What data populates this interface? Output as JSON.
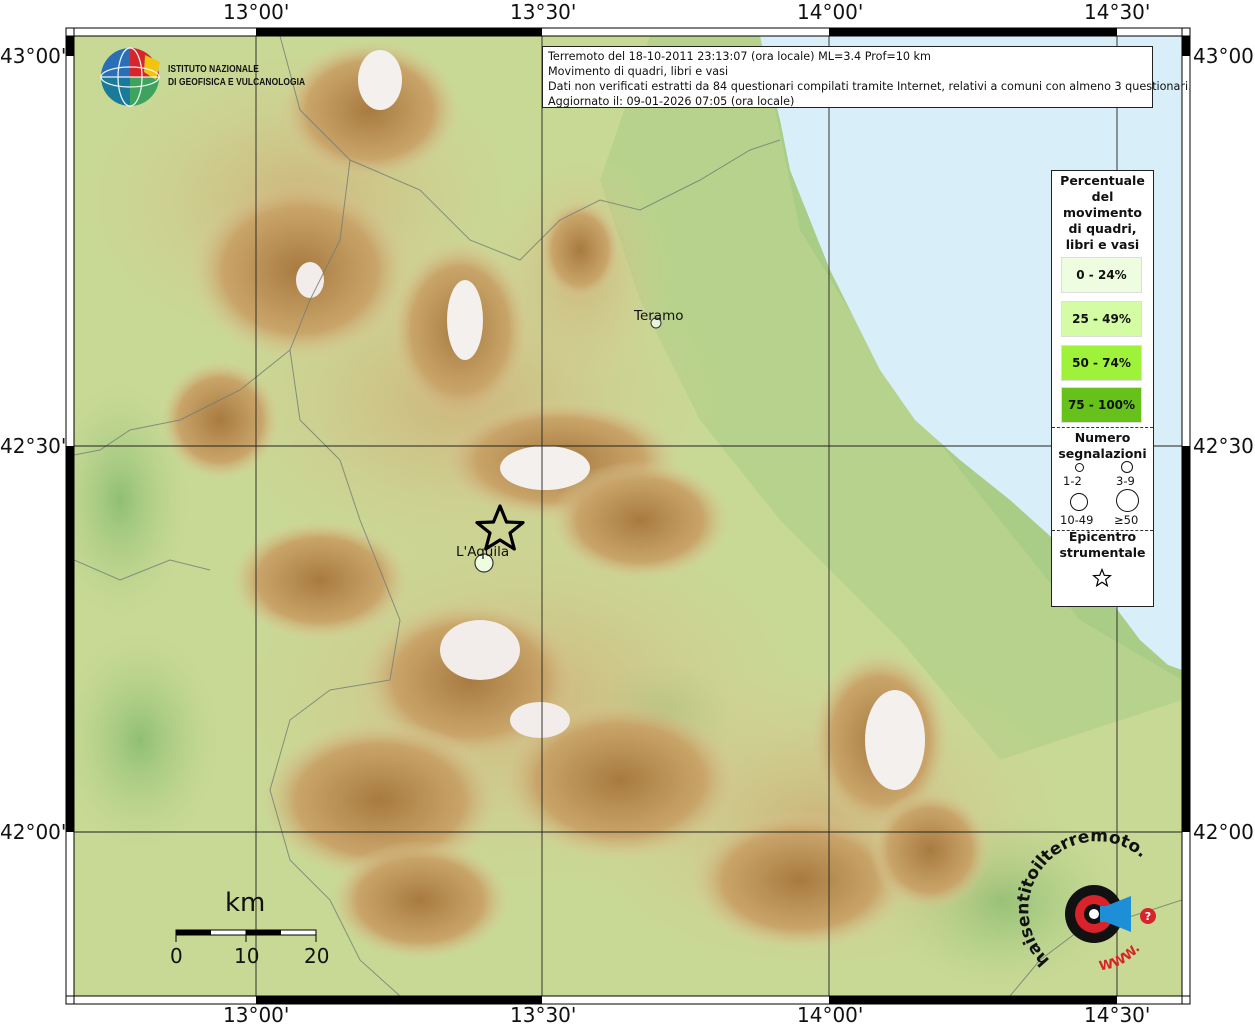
{
  "header": {
    "line1": "Terremoto del 18-10-2011 23:13:07 (ora locale) ML=3.4 Prof=10 km",
    "line2": "Movimento di quadri, libri e vasi",
    "line3": "Dati non verificati estratti da 84 questionari compilati tramite Internet, relativi a comuni con almeno 3 questionari.",
    "line4": "Aggiornato il: 09-01-2026 07:05 (ora locale)"
  },
  "logo": {
    "line1": "ISTITUTO NAZIONALE",
    "line2": "DI GEOFISICA E VULCANOLOGIA",
    "icon": "ingv-globe-icon"
  },
  "axes": {
    "top": [
      "13°00'",
      "13°30'",
      "14°00'",
      "14°30'"
    ],
    "bottom": [
      "13°00'",
      "13°30'",
      "14°00'",
      "14°30'"
    ],
    "left": [
      "43°00'",
      "42°30'",
      "42°00'"
    ],
    "right": [
      "43°00'",
      "42°30'",
      "42°00'"
    ]
  },
  "cities": [
    {
      "name": "Teramo"
    },
    {
      "name": "L'Aquila"
    }
  ],
  "legend": {
    "title_lines": [
      "Percentuale",
      "del",
      "movimento",
      "di quadri,",
      "libri e vasi"
    ],
    "classes": [
      {
        "label": "0 - 24%",
        "color": "#eefce0"
      },
      {
        "label": "25 - 49%",
        "color": "#d3fca4"
      },
      {
        "label": "50 - 74%",
        "color": "#9ef23a"
      },
      {
        "label": "75 - 100%",
        "color": "#66c21a"
      }
    ],
    "count_title_lines": [
      "Numero",
      "segnalazioni"
    ],
    "count_labels": [
      "1-2",
      "3-9",
      "10-49",
      "≥50"
    ],
    "epicenter_title_lines": [
      "Epicentro",
      "strumentale"
    ],
    "epicenter_icon": "star-icon"
  },
  "scale": {
    "unit": "km",
    "labels": [
      "0",
      "10",
      "20"
    ]
  },
  "watermark": {
    "text": "haisentitoilterremoto.it",
    "url_text": "WWW.",
    "icon": "megaphone-icon"
  },
  "colors": {
    "sea": "#d8eef8",
    "lowland": "#b9d88f",
    "hills": "#d8c98a",
    "mountains": "#b88d4f",
    "peaks": "#f4f0ee"
  }
}
